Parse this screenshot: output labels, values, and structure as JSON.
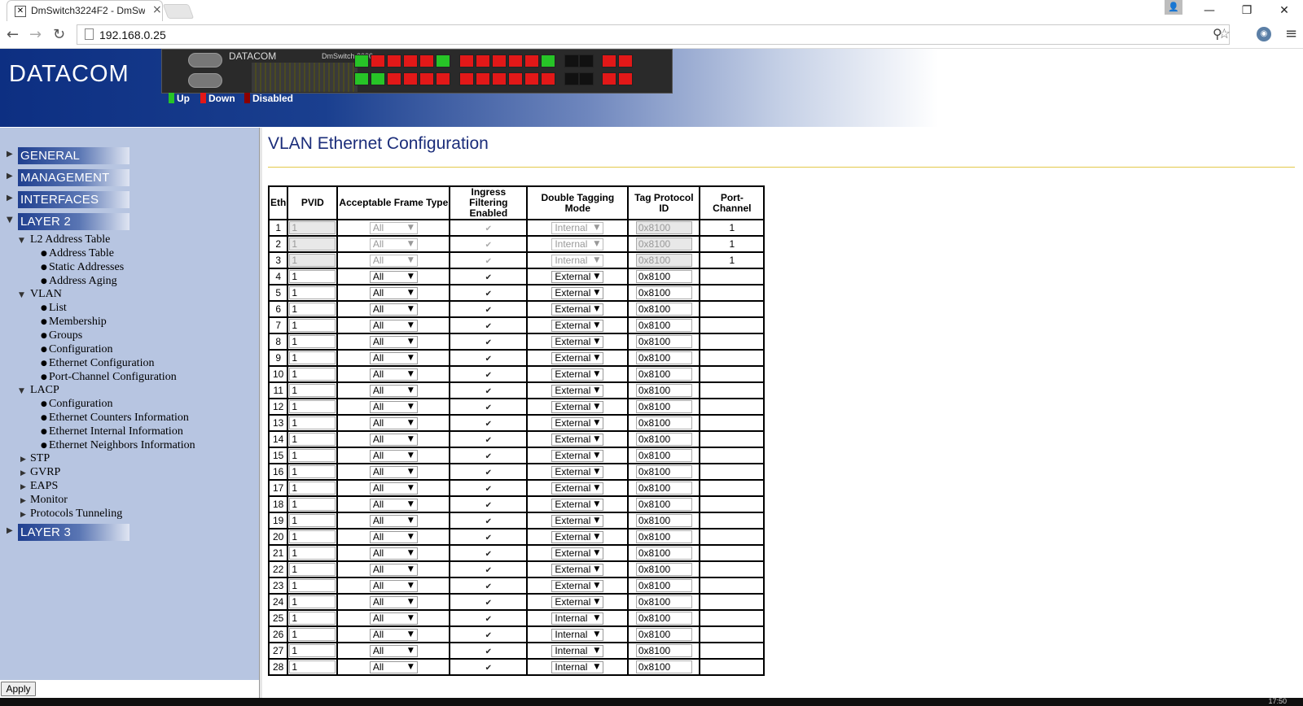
{
  "browser": {
    "tab_title": "DmSwitch3224F2 - DmSw",
    "tab_close": "×",
    "url": "192.168.0.25",
    "win_minimize": "—",
    "win_restore": "❐",
    "win_close": "✕"
  },
  "banner": {
    "logo": "DATACOM",
    "device_brand": "DATACOM",
    "device_model": "DmSwitch 3000",
    "legend": [
      {
        "label": "Up",
        "color": "#27c427"
      },
      {
        "label": "Down",
        "color": "#e21818"
      },
      {
        "label": "Disabled",
        "color": "#8b0000"
      }
    ]
  },
  "sidebar": {
    "categories": [
      "GENERAL",
      "MANAGEMENT",
      "INTERFACES",
      "LAYER 2",
      "LAYER 3"
    ],
    "l2_address_table": "L2 Address Table",
    "address_table": "Address Table",
    "static_addresses": "Static Addresses",
    "address_aging": "Address Aging",
    "vlan": "VLAN",
    "vlan_list": "List",
    "vlan_membership": "Membership",
    "vlan_groups": "Groups",
    "vlan_configuration": "Configuration",
    "vlan_ethernet_configuration": "Ethernet Configuration",
    "vlan_portchannel_configuration": "Port-Channel Configuration",
    "lacp": "LACP",
    "lacp_configuration": "Configuration",
    "lacp_counters": "Ethernet Counters Information",
    "lacp_internal": "Ethernet Internal Information",
    "lacp_neighbors": "Ethernet Neighbors Information",
    "stp": "STP",
    "gvrp": "GVRP",
    "eaps": "EAPS",
    "monitor": "Monitor",
    "protocols_tunneling": "Protocols Tunneling",
    "apply": "Apply"
  },
  "main": {
    "title": "VLAN Ethernet Configuration",
    "headers": {
      "eth": "Eth",
      "pvid": "PVID",
      "frame_type": "Acceptable Frame Type",
      "ingress_1": "Ingress Filtering",
      "ingress_2": "Enabled",
      "double_tag": "Double Tagging Mode",
      "tpid": "Tag Protocol ID",
      "port_channel": "Port-Channel"
    },
    "rows": [
      {
        "eth": "1",
        "pvid": "1",
        "frame": "All",
        "ingress": true,
        "mode": "Internal",
        "tpid": "0x8100",
        "pc": "1",
        "readonly": true
      },
      {
        "eth": "2",
        "pvid": "1",
        "frame": "All",
        "ingress": true,
        "mode": "Internal",
        "tpid": "0x8100",
        "pc": "1",
        "readonly": true
      },
      {
        "eth": "3",
        "pvid": "1",
        "frame": "All",
        "ingress": true,
        "mode": "Internal",
        "tpid": "0x8100",
        "pc": "1",
        "readonly": true
      },
      {
        "eth": "4",
        "pvid": "1",
        "frame": "All",
        "ingress": true,
        "mode": "External",
        "tpid": "0x8100",
        "pc": "",
        "readonly": false
      },
      {
        "eth": "5",
        "pvid": "1",
        "frame": "All",
        "ingress": true,
        "mode": "External",
        "tpid": "0x8100",
        "pc": "",
        "readonly": false
      },
      {
        "eth": "6",
        "pvid": "1",
        "frame": "All",
        "ingress": true,
        "mode": "External",
        "tpid": "0x8100",
        "pc": "",
        "readonly": false
      },
      {
        "eth": "7",
        "pvid": "1",
        "frame": "All",
        "ingress": true,
        "mode": "External",
        "tpid": "0x8100",
        "pc": "",
        "readonly": false
      },
      {
        "eth": "8",
        "pvid": "1",
        "frame": "All",
        "ingress": true,
        "mode": "External",
        "tpid": "0x8100",
        "pc": "",
        "readonly": false
      },
      {
        "eth": "9",
        "pvid": "1",
        "frame": "All",
        "ingress": true,
        "mode": "External",
        "tpid": "0x8100",
        "pc": "",
        "readonly": false
      },
      {
        "eth": "10",
        "pvid": "1",
        "frame": "All",
        "ingress": true,
        "mode": "External",
        "tpid": "0x8100",
        "pc": "",
        "readonly": false
      },
      {
        "eth": "11",
        "pvid": "1",
        "frame": "All",
        "ingress": true,
        "mode": "External",
        "tpid": "0x8100",
        "pc": "",
        "readonly": false
      },
      {
        "eth": "12",
        "pvid": "1",
        "frame": "All",
        "ingress": true,
        "mode": "External",
        "tpid": "0x8100",
        "pc": "",
        "readonly": false
      },
      {
        "eth": "13",
        "pvid": "1",
        "frame": "All",
        "ingress": true,
        "mode": "External",
        "tpid": "0x8100",
        "pc": "",
        "readonly": false
      },
      {
        "eth": "14",
        "pvid": "1",
        "frame": "All",
        "ingress": true,
        "mode": "External",
        "tpid": "0x8100",
        "pc": "",
        "readonly": false
      },
      {
        "eth": "15",
        "pvid": "1",
        "frame": "All",
        "ingress": true,
        "mode": "External",
        "tpid": "0x8100",
        "pc": "",
        "readonly": false
      },
      {
        "eth": "16",
        "pvid": "1",
        "frame": "All",
        "ingress": true,
        "mode": "External",
        "tpid": "0x8100",
        "pc": "",
        "readonly": false
      },
      {
        "eth": "17",
        "pvid": "1",
        "frame": "All",
        "ingress": true,
        "mode": "External",
        "tpid": "0x8100",
        "pc": "",
        "readonly": false
      },
      {
        "eth": "18",
        "pvid": "1",
        "frame": "All",
        "ingress": true,
        "mode": "External",
        "tpid": "0x8100",
        "pc": "",
        "readonly": false
      },
      {
        "eth": "19",
        "pvid": "1",
        "frame": "All",
        "ingress": true,
        "mode": "External",
        "tpid": "0x8100",
        "pc": "",
        "readonly": false
      },
      {
        "eth": "20",
        "pvid": "1",
        "frame": "All",
        "ingress": true,
        "mode": "External",
        "tpid": "0x8100",
        "pc": "",
        "readonly": false
      },
      {
        "eth": "21",
        "pvid": "1",
        "frame": "All",
        "ingress": true,
        "mode": "External",
        "tpid": "0x8100",
        "pc": "",
        "readonly": false
      },
      {
        "eth": "22",
        "pvid": "1",
        "frame": "All",
        "ingress": true,
        "mode": "External",
        "tpid": "0x8100",
        "pc": "",
        "readonly": false
      },
      {
        "eth": "23",
        "pvid": "1",
        "frame": "All",
        "ingress": true,
        "mode": "External",
        "tpid": "0x8100",
        "pc": "",
        "readonly": false
      },
      {
        "eth": "24",
        "pvid": "1",
        "frame": "All",
        "ingress": true,
        "mode": "External",
        "tpid": "0x8100",
        "pc": "",
        "readonly": false
      },
      {
        "eth": "25",
        "pvid": "1",
        "frame": "All",
        "ingress": true,
        "mode": "Internal",
        "tpid": "0x8100",
        "pc": "",
        "readonly": false
      },
      {
        "eth": "26",
        "pvid": "1",
        "frame": "All",
        "ingress": true,
        "mode": "Internal",
        "tpid": "0x8100",
        "pc": "",
        "readonly": false
      },
      {
        "eth": "27",
        "pvid": "1",
        "frame": "All",
        "ingress": true,
        "mode": "Internal",
        "tpid": "0x8100",
        "pc": "",
        "readonly": false
      },
      {
        "eth": "28",
        "pvid": "1",
        "frame": "All",
        "ingress": true,
        "mode": "Internal",
        "tpid": "0x8100",
        "pc": "",
        "readonly": false
      }
    ]
  },
  "taskbar": {
    "clock": "17:50"
  },
  "icons": {
    "back": "arrow-left-icon",
    "forward": "arrow-right-icon",
    "reload": "reload-icon",
    "page": "page-icon",
    "zoom": "zoom-icon",
    "star": "star-icon",
    "extension": "eye-extension-icon",
    "menu": "hamburger-menu-icon"
  },
  "colors": {
    "banner_blue": "#0d2f82",
    "sidebar_bg": "#b7c5e1",
    "title_blue": "#1b2d7a",
    "rule_gold": "#e3c84a",
    "port_up": "#27c427",
    "port_down": "#e21818",
    "port_disabled": "#111111"
  }
}
